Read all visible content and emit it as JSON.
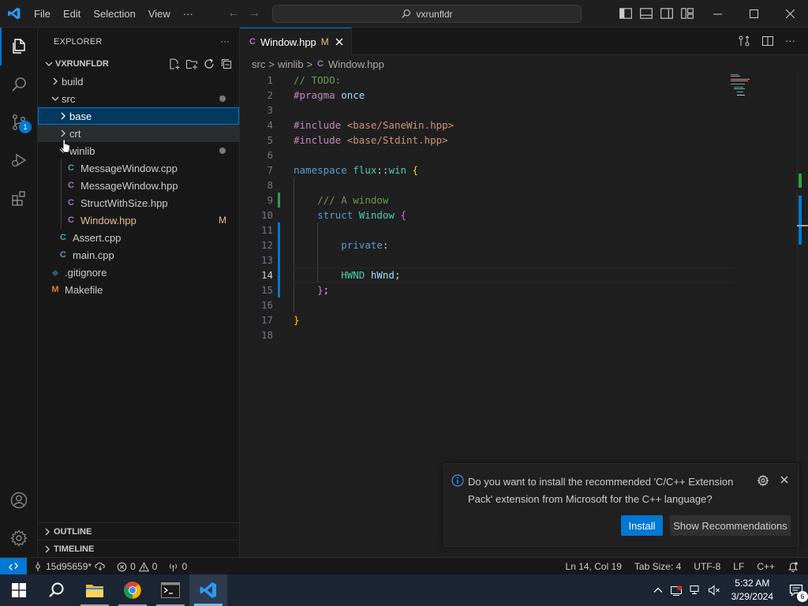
{
  "titlebar": {
    "menu": [
      "File",
      "Edit",
      "Selection",
      "View"
    ],
    "more": "···",
    "search_text": "vxrunfldr"
  },
  "activitybar": {
    "source_control_badge": "1"
  },
  "sidebar": {
    "title": "EXPLORER",
    "more": "···",
    "root": "VXRUNFLDR",
    "tree": [
      {
        "label": "build"
      },
      {
        "label": "src"
      },
      {
        "label": "base"
      },
      {
        "label": "crt"
      },
      {
        "label": "winlib"
      },
      {
        "label": "MessageWindow.cpp"
      },
      {
        "label": "MessageWindow.hpp"
      },
      {
        "label": "StructWithSize.hpp"
      },
      {
        "label": "Window.hpp",
        "status": "M"
      },
      {
        "label": "Assert.cpp"
      },
      {
        "label": "main.cpp"
      },
      {
        "label": ".gitignore"
      },
      {
        "label": "Makefile"
      }
    ],
    "outline": "OUTLINE",
    "timeline": "TIMELINE"
  },
  "editor": {
    "tab": {
      "label": "Window.hpp",
      "status": "M"
    },
    "breadcrumb": [
      "src",
      "winlib",
      "Window.hpp"
    ],
    "breadcrumb_sep": ">",
    "lines": [
      {
        "n": "1",
        "t": [
          {
            "c": "c-com",
            "s": "// TODO:"
          }
        ]
      },
      {
        "n": "2",
        "t": [
          {
            "c": "c-kw2",
            "s": "#pragma"
          },
          {
            "c": "c-text",
            "s": " "
          },
          {
            "c": "c-var",
            "s": "once"
          }
        ]
      },
      {
        "n": "3",
        "t": []
      },
      {
        "n": "4",
        "t": [
          {
            "c": "c-kw2",
            "s": "#include"
          },
          {
            "c": "c-text",
            "s": " "
          },
          {
            "c": "c-str",
            "s": "<base/SaneWin.hpp>"
          }
        ]
      },
      {
        "n": "5",
        "t": [
          {
            "c": "c-kw2",
            "s": "#include"
          },
          {
            "c": "c-text",
            "s": " "
          },
          {
            "c": "c-str",
            "s": "<base/Stdint.hpp>"
          }
        ]
      },
      {
        "n": "6",
        "t": []
      },
      {
        "n": "7",
        "t": [
          {
            "c": "c-kw",
            "s": "namespace"
          },
          {
            "c": "c-text",
            "s": " "
          },
          {
            "c": "c-ns",
            "s": "flux"
          },
          {
            "c": "c-text",
            "s": "::"
          },
          {
            "c": "c-ns",
            "s": "win"
          },
          {
            "c": "c-text",
            "s": " "
          },
          {
            "c": "c-br1",
            "s": "{"
          }
        ]
      },
      {
        "n": "8",
        "t": []
      },
      {
        "n": "9",
        "t": [
          {
            "c": "c-text",
            "s": "    "
          },
          {
            "c": "c-com",
            "s": "/// A window"
          }
        ]
      },
      {
        "n": "10",
        "t": [
          {
            "c": "c-text",
            "s": "    "
          },
          {
            "c": "c-kw",
            "s": "struct"
          },
          {
            "c": "c-text",
            "s": " "
          },
          {
            "c": "c-type",
            "s": "Window"
          },
          {
            "c": "c-text",
            "s": " "
          },
          {
            "c": "c-br2",
            "s": "{"
          }
        ]
      },
      {
        "n": "11",
        "t": []
      },
      {
        "n": "12",
        "t": [
          {
            "c": "c-text",
            "s": "        "
          },
          {
            "c": "c-kw",
            "s": "private"
          },
          {
            "c": "c-text",
            "s": ":"
          }
        ]
      },
      {
        "n": "13",
        "t": []
      },
      {
        "n": "14",
        "t": [
          {
            "c": "c-text",
            "s": "        "
          },
          {
            "c": "c-type",
            "s": "HWND"
          },
          {
            "c": "c-text",
            "s": " "
          },
          {
            "c": "c-var",
            "s": "hWnd"
          },
          {
            "c": "c-text",
            "s": ";"
          }
        ]
      },
      {
        "n": "15",
        "t": [
          {
            "c": "c-text",
            "s": "    "
          },
          {
            "c": "c-br2",
            "s": "}"
          },
          {
            "c": "c-text",
            "s": ";"
          }
        ]
      },
      {
        "n": "16",
        "t": []
      },
      {
        "n": "17",
        "t": [
          {
            "c": "c-br1",
            "s": "}"
          }
        ]
      },
      {
        "n": "18",
        "t": []
      }
    ]
  },
  "notification": {
    "message": "Do you want to install the recommended 'C/C++ Extension Pack' extension from Microsoft for the C++ language?",
    "install": "Install",
    "show": "Show Recommendations"
  },
  "statusbar": {
    "branch": "15d95659*",
    "errors": "0",
    "warnings": "0",
    "ports": "0",
    "position": "Ln 14, Col 19",
    "tabsize": "Tab Size: 4",
    "encoding": "UTF-8",
    "eol": "LF",
    "language": "C++"
  },
  "taskbar": {
    "time": "5:32 AM",
    "date": "3/29/2024",
    "notif_count": "6"
  },
  "colors": {
    "accent": "#0078d4",
    "cpp_icon": "#519aba",
    "makefile_icon": "#e37933"
  }
}
